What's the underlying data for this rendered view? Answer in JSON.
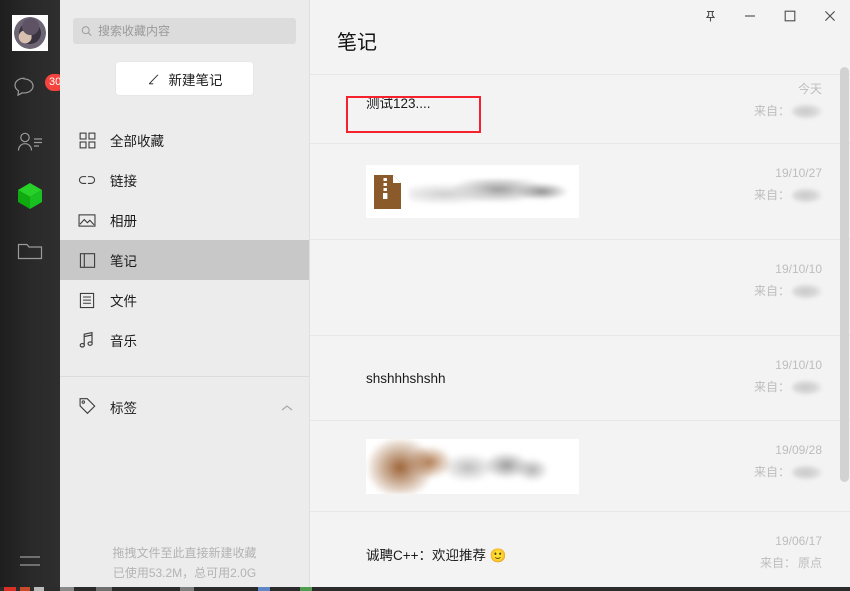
{
  "window": {
    "controls": [
      {
        "name": "pin",
        "glyph": "pin-icon"
      },
      {
        "name": "minimize",
        "glyph": "minimize-icon"
      },
      {
        "name": "maximize",
        "glyph": "maximize-icon"
      },
      {
        "name": "close",
        "glyph": "close-icon"
      }
    ]
  },
  "rail": {
    "avatar_alt": "user-avatar",
    "items": [
      {
        "id": "chats",
        "icon": "chat-bubble-icon",
        "badge": "30"
      },
      {
        "id": "contacts",
        "icon": "contacts-icon",
        "badge": ""
      },
      {
        "id": "favorites",
        "icon": "green-cube-icon",
        "badge": "",
        "selected": true,
        "color": "#18c020"
      },
      {
        "id": "files",
        "icon": "folder-icon",
        "badge": ""
      }
    ],
    "menu_icon": "hamburger-menu-icon"
  },
  "search": {
    "icon": "search-icon",
    "value": "",
    "placeholder": "搜索收藏内容"
  },
  "new_note": {
    "icon": "pencil-icon",
    "label": "新建笔记"
  },
  "sidebar": {
    "items": [
      {
        "label": "全部收藏",
        "icon": "grid-icon",
        "selected": false
      },
      {
        "label": "链接",
        "icon": "link-icon",
        "selected": false
      },
      {
        "label": "相册",
        "icon": "image-icon",
        "selected": false
      },
      {
        "label": "笔记",
        "icon": "note-icon",
        "selected": true
      },
      {
        "label": "文件",
        "icon": "document-icon",
        "selected": false
      },
      {
        "label": "音乐",
        "icon": "music-icon",
        "selected": false
      }
    ],
    "tag_section": {
      "label": "标签",
      "icon": "tag-icon",
      "chevron": "chevron-up-icon"
    },
    "footer": {
      "line1": "拖拽文件至此直接新建收藏",
      "line2": "已使用53.2M，总可用2.0G"
    }
  },
  "main": {
    "title": "笔记",
    "from_label": "来自：",
    "rows": [
      {
        "kind": "text",
        "text": "测试123....",
        "date": "今天",
        "source": "",
        "highlighted": true
      },
      {
        "kind": "file",
        "text": "",
        "file_type": "zip",
        "date": "19/10/27",
        "source": "",
        "highlighted": false
      },
      {
        "kind": "empty",
        "text": "",
        "date": "19/10/10",
        "source": "",
        "highlighted": false
      },
      {
        "kind": "text",
        "text": "shshhhshshh",
        "date": "19/10/10",
        "source": "",
        "highlighted": false
      },
      {
        "kind": "image",
        "text": "",
        "date": "19/09/28",
        "source": "",
        "highlighted": false
      },
      {
        "kind": "text",
        "text": "诚聘C++：欢迎推荐 🙂",
        "date": "19/06/17",
        "source": "原点",
        "highlighted": false
      }
    ]
  },
  "annotation": {
    "color": "#f5222d",
    "target": "测试123...."
  },
  "colors": {
    "rail_bg": "#2a2a2a",
    "nav_bg": "#ececec",
    "content_bg": "#f3f3f3",
    "selected_nav": "#c8c8c8",
    "badge_red": "#f5433d",
    "accent_green": "#18c020",
    "zip_brown": "#8a5a2b"
  }
}
